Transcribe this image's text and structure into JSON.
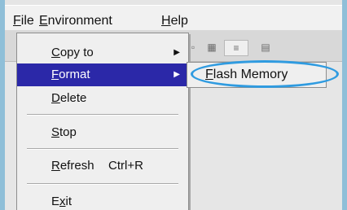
{
  "menubar": {
    "file": {
      "hotkey": "F",
      "rest": "ile"
    },
    "environment": {
      "hotkey": "E",
      "rest": "nvironment"
    },
    "help": {
      "hotkey": "H",
      "rest": "elp"
    }
  },
  "file_menu": {
    "items": [
      {
        "hotkey": "C",
        "rest": "opy to",
        "has_submenu": true
      },
      {
        "hotkey": "F",
        "rest": "ormat",
        "has_submenu": true,
        "active": true
      },
      {
        "hotkey": "D",
        "rest": "elete"
      },
      {
        "hotkey": "S",
        "rest": "top"
      },
      {
        "hotkey": "R",
        "rest": "efresh",
        "shortcut": "Ctrl+R"
      },
      {
        "hotkey": "x",
        "prefix": "E",
        "rest": "it"
      }
    ]
  },
  "submenu": {
    "item": {
      "hotkey": "F",
      "rest": "lash Memory"
    }
  },
  "colors": {
    "highlight_blue": "#2f9be0",
    "active_item_bg": "#2b28a8"
  }
}
